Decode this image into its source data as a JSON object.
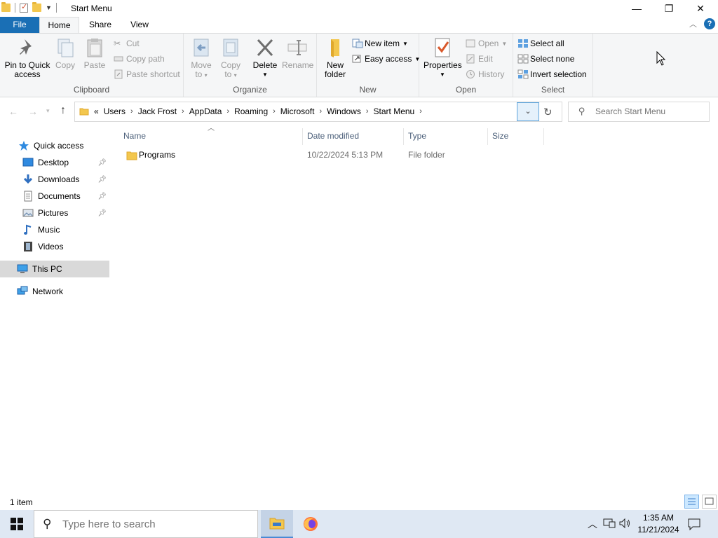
{
  "window": {
    "title": "Start Menu",
    "controls": {
      "minimize": "—",
      "restore": "❐",
      "close": "✕"
    }
  },
  "ribbon_tabs": [
    "File",
    "Home",
    "Share",
    "View"
  ],
  "ribbon": {
    "clipboard": {
      "label": "Clipboard",
      "pin": "Pin to Quick access",
      "pin_line1": "Pin to Quick",
      "pin_line2": "access",
      "copy": "Copy",
      "paste": "Paste",
      "cut": "Cut",
      "copy_path": "Copy path",
      "paste_shortcut": "Paste shortcut"
    },
    "organize": {
      "label": "Organize",
      "move_to_line1": "Move",
      "move_to_line2": "to",
      "copy_to_line1": "Copy",
      "copy_to_line2": "to",
      "delete": "Delete",
      "rename": "Rename"
    },
    "new": {
      "label": "New",
      "new_folder_line1": "New",
      "new_folder_line2": "folder",
      "new_item": "New item",
      "easy_access": "Easy access"
    },
    "open": {
      "label": "Open",
      "properties": "Properties",
      "open": "Open",
      "edit": "Edit",
      "history": "History"
    },
    "select": {
      "label": "Select",
      "select_all": "Select all",
      "select_none": "Select none",
      "invert_selection": "Invert selection"
    }
  },
  "address": {
    "overflow": "«",
    "crumbs": [
      "Users",
      "Jack Frost",
      "AppData",
      "Roaming",
      "Microsoft",
      "Windows",
      "Start Menu"
    ]
  },
  "search": {
    "placeholder": "Search Start Menu"
  },
  "nav_pane": {
    "quick_access": "Quick access",
    "items": [
      {
        "label": "Desktop",
        "icon": "desktop-icon",
        "pinned": true
      },
      {
        "label": "Downloads",
        "icon": "downloads-icon",
        "pinned": true
      },
      {
        "label": "Documents",
        "icon": "documents-icon",
        "pinned": true
      },
      {
        "label": "Pictures",
        "icon": "pictures-icon",
        "pinned": true
      },
      {
        "label": "Music",
        "icon": "music-icon",
        "pinned": false
      },
      {
        "label": "Videos",
        "icon": "videos-icon",
        "pinned": false
      }
    ],
    "this_pc": "This PC",
    "network": "Network"
  },
  "columns": [
    "Name",
    "Date modified",
    "Type",
    "Size"
  ],
  "files": [
    {
      "name": "Programs",
      "date_modified": "10/22/2024 5:13 PM",
      "type": "File folder",
      "size": ""
    }
  ],
  "status": {
    "item_count": "1 item"
  },
  "taskbar": {
    "search_placeholder": "Type here to search",
    "time": "1:35 AM",
    "date": "11/21/2024"
  },
  "colors": {
    "file_tab": "#1a6fb5",
    "ribbon_bg": "#f5f6f7",
    "selected_nav": "#d9d9d9",
    "taskbar_bg": "#dfe8f3",
    "folder": "#f3c74e"
  }
}
